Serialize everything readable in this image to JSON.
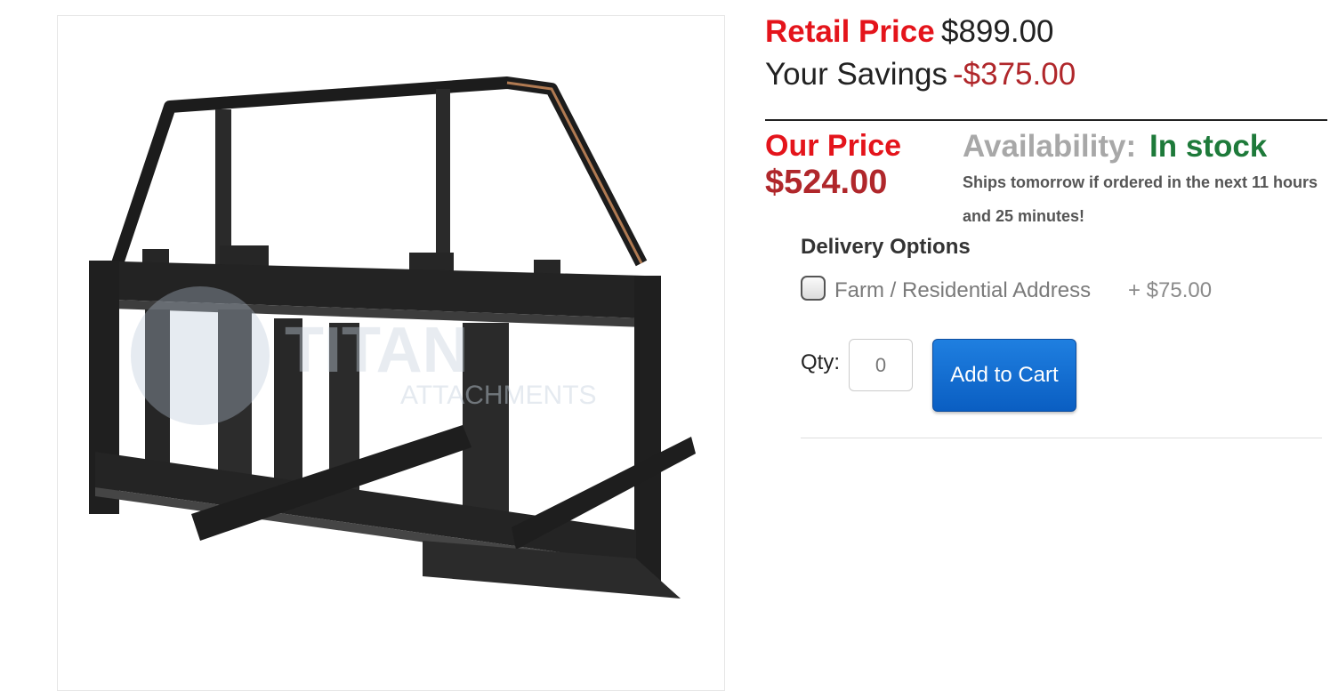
{
  "product": {
    "image_alt": "Pallet fork attachment",
    "watermark_line1": "TITAN",
    "watermark_line2": "ATTACHMENTS"
  },
  "pricing": {
    "retail_label": "Retail Price",
    "retail_value": "$899.00",
    "savings_label": "Your Savings",
    "savings_value": "-$375.00",
    "our_price_label": "Our Price",
    "our_price_value": "$524.00"
  },
  "availability": {
    "label": "Availability:",
    "status": "In stock",
    "shipping_note": "Ships tomorrow if ordered in the next 11 hours and 25 minutes!"
  },
  "delivery": {
    "title": "Delivery Options",
    "option_label": "Farm / Residential Address",
    "option_price": "+ $75.00",
    "option_checked": false
  },
  "cart": {
    "qty_label": "Qty:",
    "qty_placeholder": "0",
    "add_button_label": "Add to Cart"
  },
  "colors": {
    "retail_red": "#e4141b",
    "price_red": "#b0272b",
    "in_stock_green": "#1e7a3a",
    "button_blue": "#0a5ec2"
  }
}
